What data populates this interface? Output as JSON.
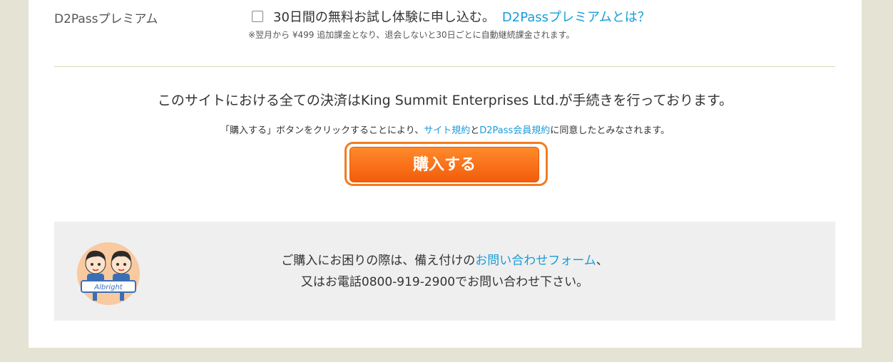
{
  "premium": {
    "label": "D2Passプレミアム",
    "checkbox_text": "30日間の無料お試し体験に申し込む。",
    "info_link": "D2Passプレミアムとは？",
    "note": "※翌月から ¥499 追加課金となり、退会しないと30日ごとに自動継続課金されます。"
  },
  "settlement_text": "このサイトにおける全ての決済はKing Summit Enterprises Ltd.が手続きを行っております。",
  "consent": {
    "prefix": "「購入する」ボタンをクリックすることにより、",
    "site_terms_link": "サイト規約",
    "connector": "と",
    "member_terms_link": "D2Pass会員規約",
    "suffix": "に同意したとみなされます。"
  },
  "buy_button": "購入する",
  "help": {
    "mascot_text": "Albright",
    "line1_prefix": "ご購入にお困りの際は、備え付けの",
    "form_link": "お問い合わせフォーム",
    "line1_suffix": "、",
    "line2": "又はお電話0800-919-2900でお問い合わせ下さい。"
  },
  "colors": {
    "link": "#1a9cd8",
    "button": "#f45c0b",
    "button_outline": "#f37c1e",
    "frame": "#e5e3d3"
  }
}
